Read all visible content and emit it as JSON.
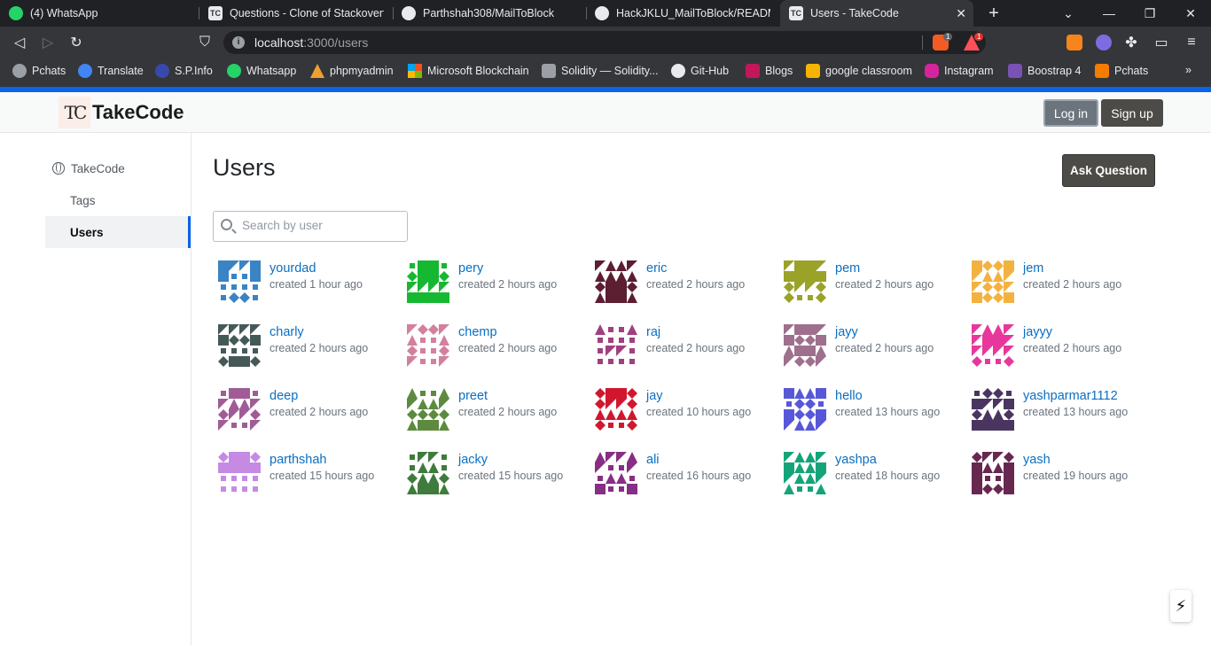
{
  "browser": {
    "tabs": [
      {
        "title": "(4) WhatsApp",
        "icon": "whatsapp-icon",
        "color": "#25d366"
      },
      {
        "title": "Questions - Clone of Stackoverflow",
        "icon": "takecode-icon",
        "color": "#e8eaed"
      },
      {
        "title": "Parthshah308/MailToBlock",
        "icon": "github-icon",
        "color": "#e8eaed"
      },
      {
        "title": "HackJKLU_MailToBlock/README.m",
        "icon": "github-icon",
        "color": "#e8eaed"
      },
      {
        "title": "Users - TakeCode",
        "icon": "takecode-icon",
        "color": "#e8eaed"
      }
    ],
    "url_host": "localhost",
    "url_path": ":3000/users",
    "brave_badge": "1",
    "alert_badge": "1",
    "bookmarks": [
      {
        "label": "Pchats",
        "color": "#9aa0a6"
      },
      {
        "label": "Translate",
        "color": "#4285f4"
      },
      {
        "label": "S.P.Info",
        "color": "#3949ab"
      },
      {
        "label": "Whatsapp",
        "color": "#25d366"
      },
      {
        "label": "phpmyadmin",
        "color": "#f0a030"
      },
      {
        "label": "Microsoft Blockchain",
        "color": "#f25022"
      },
      {
        "label": "Solidity — Solidity...",
        "color": "#9aa0a6"
      },
      {
        "label": "Git-Hub",
        "color": "#e8eaed"
      },
      {
        "label": "Blogs",
        "color": "#c2185b"
      },
      {
        "label": "google classroom",
        "color": "#f4b400"
      },
      {
        "label": "Instagram",
        "color": "#d6249f"
      },
      {
        "label": "Boostrap 4",
        "color": "#7952b3"
      },
      {
        "label": "Pchats",
        "color": "#f57c00"
      }
    ]
  },
  "site": {
    "logo_mark": "TC",
    "logo_text": "TakeCode",
    "login_label": "Log in",
    "signup_label": "Sign up"
  },
  "sidebar": {
    "items": [
      {
        "label": "TakeCode",
        "icon": "globe-icon"
      },
      {
        "label": "Tags"
      },
      {
        "label": "Users",
        "active": true
      }
    ]
  },
  "main": {
    "title": "Users",
    "ask_label": "Ask Question",
    "search_placeholder": "Search by user",
    "users": [
      {
        "name": "yourdad",
        "created": "created 1 hour ago",
        "color": "#3a83c4"
      },
      {
        "name": "pery",
        "created": "created 2 hours ago",
        "color": "#16b832"
      },
      {
        "name": "eric",
        "created": "created 2 hours ago",
        "color": "#5b1f31"
      },
      {
        "name": "pem",
        "created": "created 2 hours ago",
        "color": "#9aa228"
      },
      {
        "name": "jem",
        "created": "created 2 hours ago",
        "color": "#f3b240"
      },
      {
        "name": "charly",
        "created": "created 2 hours ago",
        "color": "#455a58"
      },
      {
        "name": "chemp",
        "created": "created 2 hours ago",
        "color": "#d3809e"
      },
      {
        "name": "raj",
        "created": "created 2 hours ago",
        "color": "#a0407e"
      },
      {
        "name": "jayy",
        "created": "created 2 hours ago",
        "color": "#9e708d"
      },
      {
        "name": "jayyy",
        "created": "created 2 hours ago",
        "color": "#e8379c"
      },
      {
        "name": "deep",
        "created": "created 2 hours ago",
        "color": "#a05c96"
      },
      {
        "name": "preet",
        "created": "created 2 hours ago",
        "color": "#5e8a3f"
      },
      {
        "name": "jay",
        "created": "created 10 hours ago",
        "color": "#d0172d"
      },
      {
        "name": "hello",
        "created": "created 13 hours ago",
        "color": "#5857d8"
      },
      {
        "name": "yashparmar1112",
        "created": "created 13 hours ago",
        "color": "#4a3561"
      },
      {
        "name": "parthshah",
        "created": "created 15 hours ago",
        "color": "#c58be4"
      },
      {
        "name": "jacky",
        "created": "created 15 hours ago",
        "color": "#3f7b3c"
      },
      {
        "name": "ali",
        "created": "created 16 hours ago",
        "color": "#862f84"
      },
      {
        "name": "yashpa",
        "created": "created 18 hours ago",
        "color": "#15a47a"
      },
      {
        "name": "yash",
        "created": "created 19 hours ago",
        "color": "#672850"
      }
    ]
  }
}
